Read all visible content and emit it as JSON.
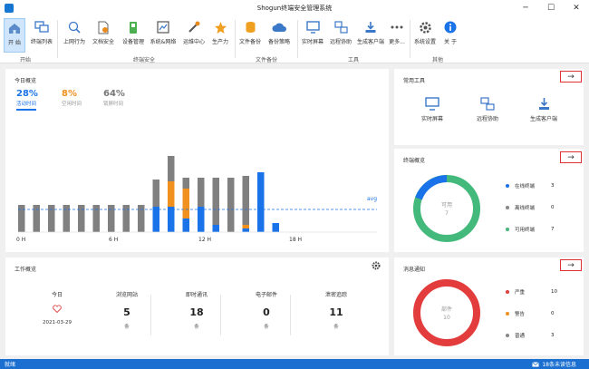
{
  "window": {
    "title": "Shogun终端安全管理系统",
    "minimize": "─",
    "maximize": "☐",
    "close": "✕"
  },
  "ribbon": {
    "items": [
      {
        "label": "开 始",
        "icon": "home-icon"
      },
      {
        "label": "终端列表",
        "icon": "monitor-list-icon"
      },
      {
        "label": "上网行为",
        "icon": "web-behavior-icon"
      },
      {
        "label": "文档安全",
        "icon": "document-security-icon"
      },
      {
        "label": "设备管理",
        "icon": "device-management-icon"
      },
      {
        "label": "系统&网络",
        "icon": "system-network-icon"
      },
      {
        "label": "运维中心",
        "icon": "ops-center-icon"
      },
      {
        "label": "生产力",
        "icon": "productivity-icon"
      },
      {
        "label": "文件备份",
        "icon": "file-backup-icon"
      },
      {
        "label": "备份策略",
        "icon": "backup-policy-icon"
      },
      {
        "label": "实时屏幕",
        "icon": "realtime-screen-icon"
      },
      {
        "label": "远程协助",
        "icon": "remote-assist-icon"
      },
      {
        "label": "生成客户端",
        "icon": "generate-client-icon"
      },
      {
        "label": "更多...",
        "icon": "more-icon"
      },
      {
        "label": "系统设置",
        "icon": "settings-icon"
      },
      {
        "label": "关 于",
        "icon": "about-icon"
      }
    ],
    "groups": [
      "开始",
      "终端安全",
      "文件备份",
      "工具",
      "其他"
    ]
  },
  "today": {
    "title": "今日概览",
    "stats": [
      {
        "value": "28%",
        "label": "活动时间",
        "color": "#1a73e8"
      },
      {
        "value": "8%",
        "label": "空闲时间",
        "color": "#f0901e"
      },
      {
        "value": "64%",
        "label": "锁屏时间",
        "color": "#777777"
      }
    ],
    "avg_label": "avg",
    "x_ticks": [
      "0 H",
      "6 H",
      "12 H",
      "18 H"
    ]
  },
  "chart_data": {
    "type": "bar",
    "stacked": true,
    "x": [
      "0",
      "1",
      "2",
      "3",
      "4",
      "5",
      "6",
      "7",
      "8",
      "9",
      "10",
      "11",
      "12",
      "13",
      "14",
      "15",
      "16",
      "17",
      "18",
      "19",
      "20",
      "21",
      "22",
      "23"
    ],
    "series": [
      {
        "name": "活动时间",
        "color": "#1a73e8",
        "values": [
          0,
          0,
          0,
          0,
          0,
          0,
          0,
          0,
          0,
          28,
          28,
          15,
          28,
          8,
          0,
          4,
          66,
          10,
          0,
          0,
          0,
          0,
          0,
          0
        ]
      },
      {
        "name": "空闲时间",
        "color": "#f0901e",
        "values": [
          0,
          0,
          0,
          0,
          0,
          0,
          0,
          0,
          0,
          0,
          28,
          33,
          0,
          0,
          0,
          4,
          0,
          0,
          0,
          0,
          0,
          0,
          0,
          0
        ]
      },
      {
        "name": "锁屏时间",
        "color": "#808080",
        "values": [
          30,
          30,
          30,
          30,
          30,
          30,
          30,
          30,
          30,
          30,
          28,
          12,
          32,
          52,
          60,
          54,
          0,
          0,
          0,
          0,
          0,
          0,
          0,
          0
        ]
      }
    ],
    "avg": 25
  },
  "common_tools": {
    "title": "常用工具",
    "items": [
      {
        "label": "实时屏幕",
        "icon": "realtime-screen-icon"
      },
      {
        "label": "远程协助",
        "icon": "remote-assist-icon"
      },
      {
        "label": "生成客户端",
        "icon": "generate-client-icon"
      }
    ]
  },
  "terminal_overview": {
    "title": "终端概览",
    "center_label": "可用",
    "center_value": "7",
    "legend": [
      {
        "label": "在线终端",
        "value": "3",
        "color": "#1a73e8"
      },
      {
        "label": "离线终端",
        "value": "0",
        "color": "#888888"
      },
      {
        "label": "可用终端",
        "value": "7",
        "color": "#44b97c"
      }
    ]
  },
  "work_overview": {
    "title": "工作概览",
    "today_label": "今日",
    "date": "2021-03-29",
    "cols": [
      {
        "header": "浏览网站",
        "value": "5",
        "unit": "条"
      },
      {
        "header": "即时通讯",
        "value": "18",
        "unit": "条"
      },
      {
        "header": "电子邮件",
        "value": "0",
        "unit": "条"
      },
      {
        "header": "泄密追踪",
        "value": "11",
        "unit": "条"
      }
    ]
  },
  "messages": {
    "title": "消息通知",
    "center_label": "部件",
    "center_value": "10",
    "legend": [
      {
        "label": "严重",
        "value": "10",
        "color": "#e23c3c"
      },
      {
        "label": "警告",
        "value": "0",
        "color": "#f0901e"
      },
      {
        "label": "普通",
        "value": "3",
        "color": "#888888"
      }
    ]
  },
  "status": {
    "left": "就绪",
    "right": "18条未读信息"
  }
}
